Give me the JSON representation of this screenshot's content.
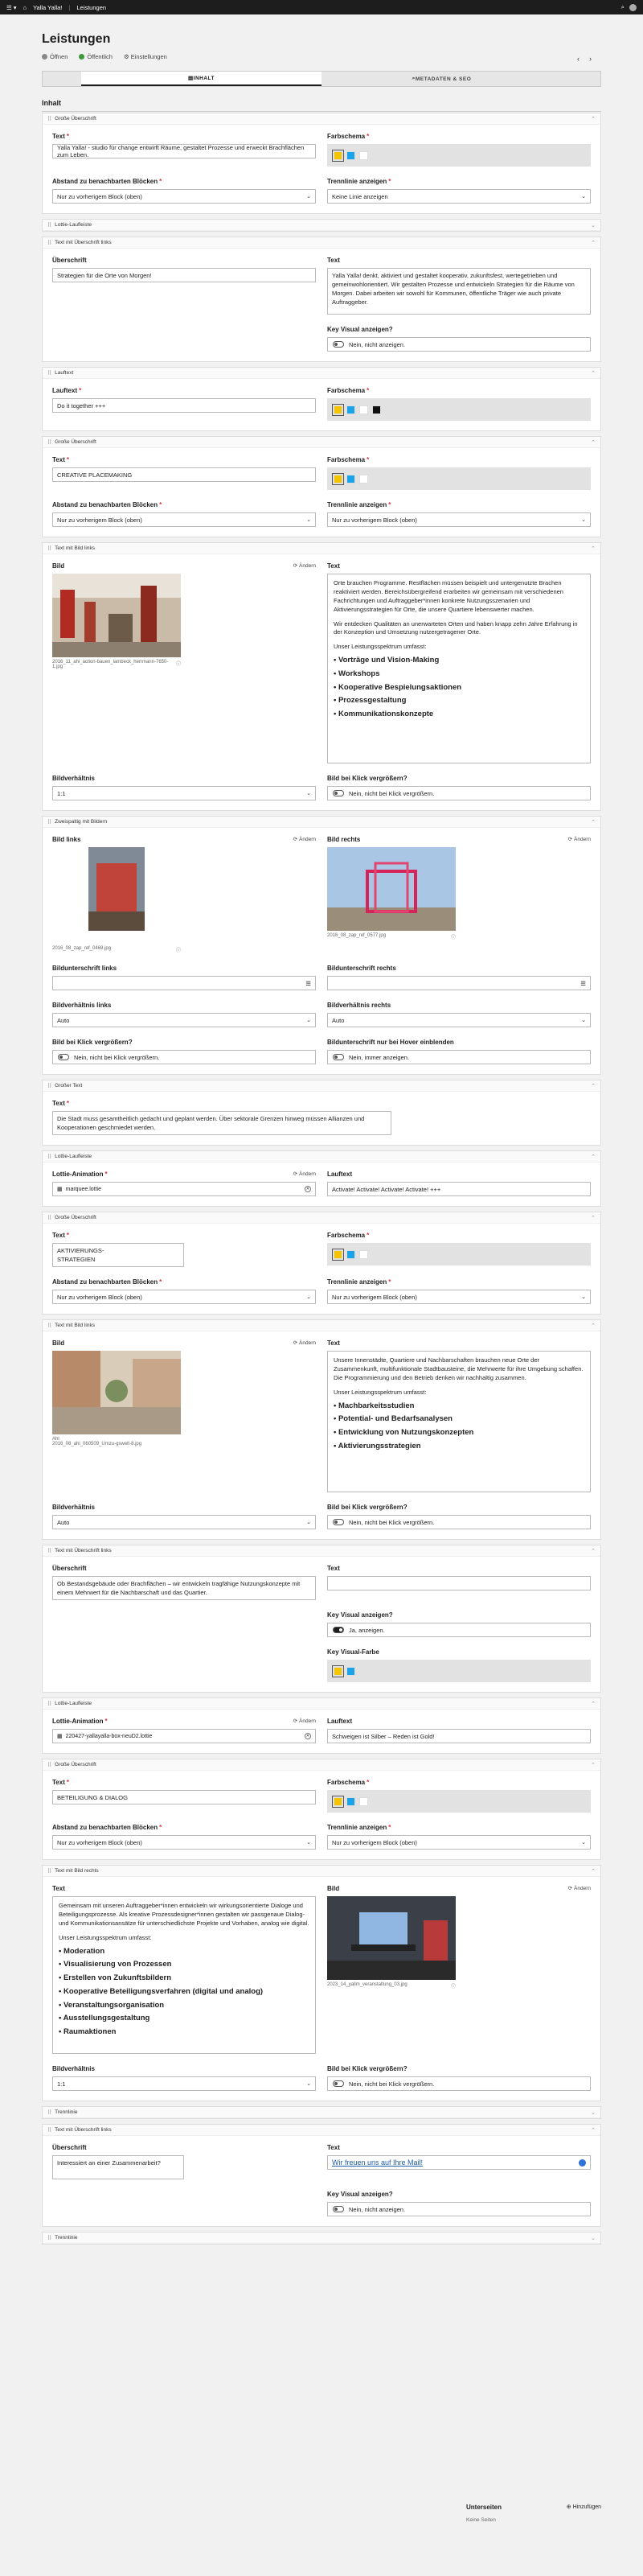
{
  "topbar": {
    "site": "Yalla Yalla!",
    "page": "Leistungen"
  },
  "page": {
    "title": "Leistungen",
    "meta": [
      "Öffnen",
      "Öffentlich",
      "Einstellungen"
    ]
  },
  "tabs": [
    "INHALT",
    "METADATEN & SEO"
  ],
  "section": "Inhalt",
  "colors": {
    "yellow": "#f5c400",
    "blue": "#1aa3e8",
    "white": "#ffffff",
    "black": "#111111"
  },
  "labels": {
    "text": "Text",
    "farbschema": "Farbschema",
    "abstand": "Abstand zu benachbarten Blöcken",
    "trennlinie": "Trennlinie anzeigen",
    "ueberschrift": "Überschrift",
    "keyvisual": "Key Visual anzeigen?",
    "laufText": "Lauftext",
    "bild": "Bild",
    "bildverh": "Bildverhältnis",
    "bildklick": "Bild bei Klick vergrößern?",
    "bildlinks": "Bild links",
    "bildrechts": "Bild rechts",
    "bu_links": "Bildunterschrift links",
    "bu_rechts": "Bildunterschrift rechts",
    "bv_links": "Bildverhältnis links",
    "bv_rechts": "Bildverhältnis rechts",
    "bu_hover": "Bildunterschrift nur bei Hover einblenden",
    "lottie": "Lottie-Animation",
    "kvfarbe": "Key Visual-Farbe",
    "aendern": "Ändern"
  },
  "values": {
    "abstand": "Nur zu vorherigem Block (oben)",
    "keine_linie": "Keine Linie anzeigen",
    "nein_anzeigen": "Nein, nicht anzeigen.",
    "ja_anzeigen": "Ja, anzeigen.",
    "nein_klick": "Nein, nicht bei Klick vergrößern.",
    "nein_immer": "Nein, immer anzeigen.",
    "ratio11": "1:1",
    "auto": "Auto"
  },
  "blocks": [
    {
      "type": "Große Überschrift",
      "text": "Yalla Yalla! - studio für change entwirft Räume, gestaltet Prozesse und erweckt Brachflächen zum Leben."
    },
    {
      "type": "Lottie-Laufleiste"
    },
    {
      "type": "Text mit Überschrift links",
      "heading": "Strategien für die Orte von Morgen!",
      "text": "Yalla Yalla! denkt, aktiviert und gestaltet kooperativ, zukunftsfest, wertegetrieben und gemeinwohlorientiert. Wir gestalten Prozesse und entwickeln Strategien für die Räume von Morgen. Dabei arbeiten wir sowohl für Kommunen, öffentliche Träger wie auch private Auftraggeber."
    },
    {
      "type": "Lauftext",
      "text": "Do it together +++"
    },
    {
      "type": "Große Überschrift",
      "text": "CREATIVE PLACEMAKING"
    },
    {
      "type": "Text mit Bild links",
      "file": "2016_11_ahi_action-bauen_lambeck_herrmann-7650-1.jpg",
      "p1": "Orte brauchen Programme. Restflächen müssen beispielt und untergenutzte Brachen reaktiviert werden. Bereichsübergreifend erarbeiten wir gemeinsam mit verschiedenen Fachrichtungen und Auftraggeber*innen konkrete Nutzungsszenarien und Aktivierungsstrategien für Orte, die unsere Quartiere lebenswerter machen.",
      "p2": "Wir entdecken Qualitäten an unerwarteten Orten und haben knapp zehn Jahre Erfahrung in der Konzeption und Umsetzung nutzergetragener Orte.",
      "sub": "Unser Leistungsspektrum umfasst:",
      "list": [
        "Vorträge und Vision-Making",
        "Workshops",
        "Kooperative Bespielungsaktionen",
        "Prozessgestaltung",
        "Kommunikationskonzepte"
      ]
    },
    {
      "type": "Zweispaltig mit Bildern",
      "file_l": "2016_08_zap_ref_0469.jpg",
      "file_r": "2016_08_zap_ref_0577.jpg"
    },
    {
      "type": "Großer Text",
      "text": "Die Stadt muss gesamtheitlich gedacht und geplant werden. Über sektorale Grenzen hinweg müssen Allianzen und Kooperationen geschmiedet werden."
    },
    {
      "type": "Lottie-Laufleiste",
      "file": "marquee.lottie",
      "text": "Activate! Activate! Activate! Activate! +++"
    },
    {
      "type": "Große Überschrift",
      "text": "AKTIVIERUNGS-\nSTRATEGIEN"
    },
    {
      "type": "Text mit Bild links",
      "file": "2016_08_ahi_060509_Umzu-gswelt-8.jpg",
      "caption": "Ahl",
      "p1": "Unsere Innenstädte, Quartiere und Nachbarschaften brauchen neue Orte der Zusammenkunft, multifunktionale Stadtbausteine, die Mehrwerte für ihre Umgebung schaffen. Die Programmierung und den Betrieb denken wir nachhaltig zusammen.",
      "sub": "Unser Leistungsspektrum umfasst:",
      "list": [
        "Machbarkeitsstudien",
        "Potential- und Bedarfsanalysen",
        "Entwicklung von Nutzungskonzepten",
        "Aktivierungsstrategien"
      ]
    },
    {
      "type": "Text mit Überschrift links",
      "heading": "Ob Bestandsgebäude oder Brachflächen – wir entwickeln tragfähige Nutzungskonzepte mit einem Mehrwert für die Nachbarschaft und das Quartier."
    },
    {
      "type": "Lottie-Laufleiste",
      "file": "220427-yallayalla-box-neuD2.lottie",
      "text": "Schweigen ist Silber – Reden ist Gold!"
    },
    {
      "type": "Große Überschrift",
      "text": "BETEILIGUNG & DIALOG"
    },
    {
      "type": "Text mit Bild rechts",
      "file": "2023_14_yallm_veranstaltung_03.jpg",
      "p1": "Gemeinsam mit unseren Auftraggeber*innen entwickeln wir wirkungsorientierte Dialoge und Beteiligungsprozesse. Als kreative Prozessdesigner*innen gestalten wir passgenaue Dialog- und Kommunikationsansätze für unterschiedlichste Projekte und Vorhaben, analog wie digital.",
      "sub": "Unser Leistungsspektrum umfasst:",
      "list": [
        "Moderation",
        "Visualisierung von Prozessen",
        "Erstellen von Zukunftsbildern",
        "Kooperative Beteiligungsverfahren (digital und analog)",
        "Veranstaltungsorganisation",
        "Ausstellungsgestaltung",
        "Raumaktionen"
      ]
    },
    {
      "type": "Trennlinie"
    },
    {
      "type": "Text mit Überschrift links",
      "heading": "Interessiert an einer Zusammenarbeit?",
      "link": "Wir freuen uns auf Ihre Mail!"
    },
    {
      "type": "Trennlinie"
    }
  ],
  "footer": {
    "title": "Unterseiten",
    "add": "Hinzufügen",
    "none": "Keine Seiten"
  }
}
